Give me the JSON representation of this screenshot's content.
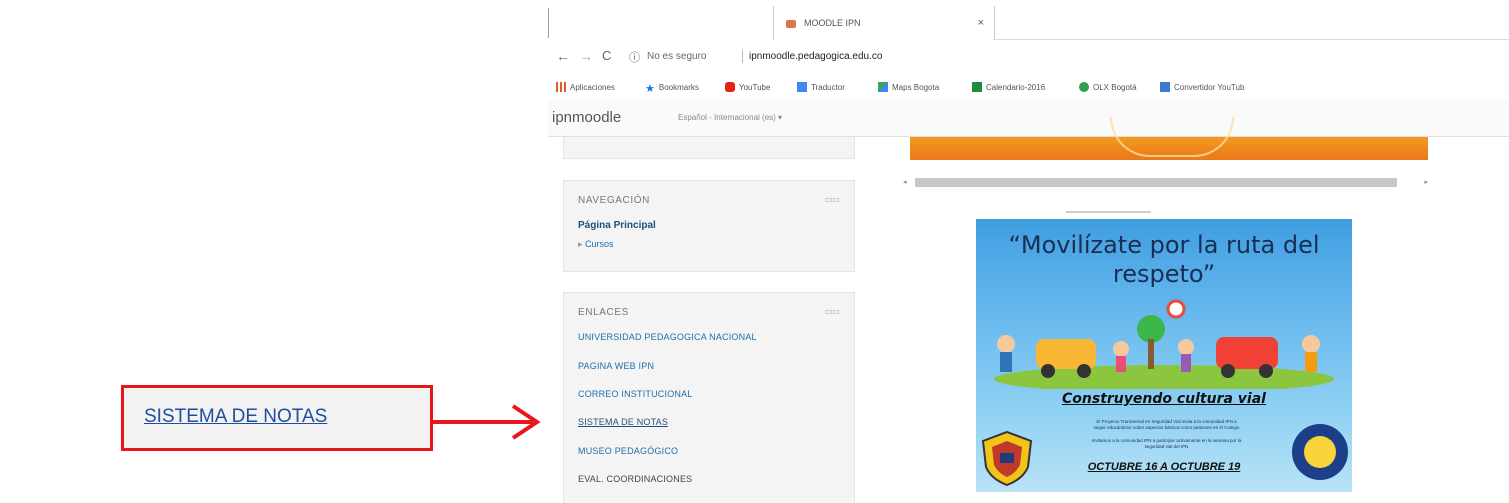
{
  "callout": {
    "text": "SISTEMA DE NOTAS"
  },
  "browser": {
    "tab_title": "MOODLE IPN",
    "tab_close": "×",
    "nav": {
      "back": "←",
      "forward": "→",
      "reload": "C"
    },
    "security_text": "No es seguro",
    "url": "ipnmoodle.pedagogica.edu.co",
    "bookmarks": [
      {
        "label": "Aplicaciones",
        "icon": "apps-grid-icon",
        "color": "#e25b2b"
      },
      {
        "label": "Bookmarks",
        "icon": "star-icon",
        "color": "#1a73e8"
      },
      {
        "label": "YouTube",
        "icon": "youtube-icon",
        "color": "#e62117"
      },
      {
        "label": "Traductor",
        "icon": "translate-icon",
        "color": "#4285f4"
      },
      {
        "label": "Maps Bogota",
        "icon": "maps-icon",
        "color": "#34a853"
      },
      {
        "label": "Calendario-2016",
        "icon": "calendar-icon",
        "color": "#1e8e3e"
      },
      {
        "label": "OLX Bogotá",
        "icon": "olx-icon",
        "color": "#2ca14e"
      },
      {
        "label": "Convertidor YouTub",
        "icon": "converter-icon",
        "color": "#3b7bd4"
      }
    ]
  },
  "moodle": {
    "brand": "ipnmoodle",
    "language": "Español - Internacional (es) ▾",
    "navigation": {
      "title": "NAVEGACIÓN",
      "home": "Página Principal",
      "courses": "Cursos"
    },
    "links": {
      "title": "ENLACES",
      "items": [
        "UNIVERSIDAD PEDAGOGICA NACIONAL",
        "PAGINA WEB IPN",
        "CORREO INSTITUCIONAL",
        "SISTEMA DE NOTAS",
        "MUSEO PEDAGÓGICO",
        "EVAL. COORDINACIONES"
      ]
    },
    "poster": {
      "title_line1": "“Movilízate por la ruta del",
      "title_line2": "respeto”",
      "subtitle": "Construyendo cultura vial",
      "note_line1": "El Proyecto Transversal en Seguridad Vial invita a la comunidad IPN a",
      "note_line2": "seguir educándose sobre aspectos básicos como peatones en el Colegio",
      "note_line3": "Invitamos a la comunidad IPN a participar activamente en la semana por la",
      "note_line4": "seguridad vial del IPN",
      "dates": "OCTUBRE 16 A OCTUBRE 19"
    }
  }
}
